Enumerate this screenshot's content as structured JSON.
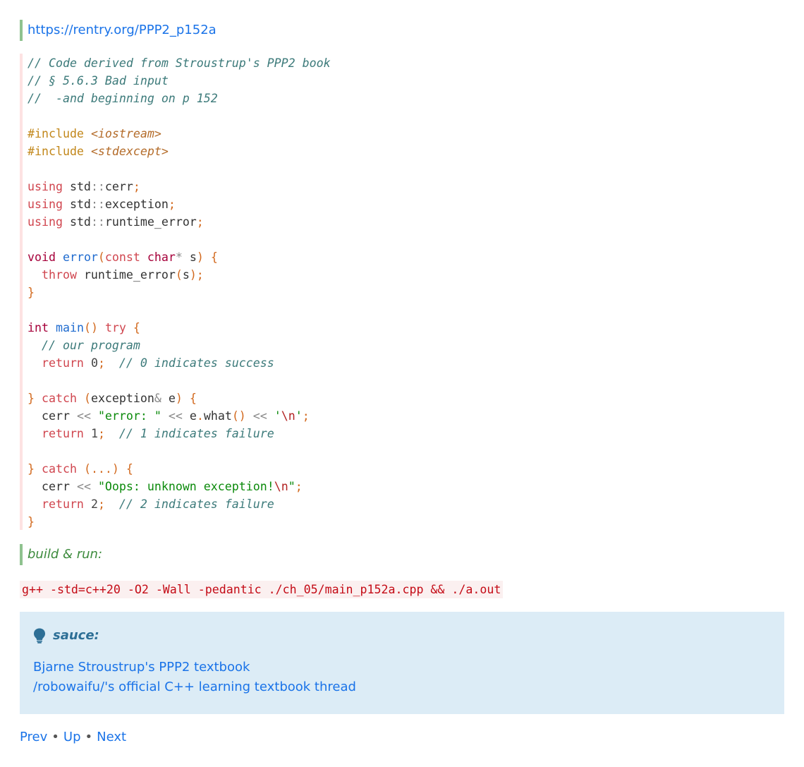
{
  "top_link": {
    "text": "https://rentry.org/PPP2_p152a"
  },
  "code": {
    "c1": "// Code derived from Stroustrup's PPP2 book",
    "c2": "// § 5.6.3 Bad input",
    "c3": "//  -and beginning on p 152",
    "include_kw": "#include",
    "inc1": "<iostream>",
    "inc2": "<stdexcept>",
    "using_kw": "using",
    "std_ns": "std",
    "scope": "::",
    "cerr": "cerr",
    "exception": "exception",
    "runtime_error": "runtime_error",
    "void_kw": "void",
    "error_fn": "error",
    "const_kw": "const",
    "char_kw": "char",
    "star": "*",
    "s": "s",
    "throw_kw": "throw",
    "int_kw": "int",
    "main_fn": "main",
    "try_kw": "try",
    "c_program": "// our program",
    "return_kw": "return",
    "n0": "0",
    "n1": "1",
    "n2": "2",
    "c_success": "// 0 indicates success",
    "catch_kw": "catch",
    "amp": "&",
    "e": "e",
    "shl": "<<",
    "str_error": "\"error: \"",
    "dot": ".",
    "what": "what",
    "newline_char_open": "'",
    "esc_n": "\\n",
    "c_fail1": "// 1 indicates failure",
    "ellipsis": "(...)",
    "str_oops_open": "\"Oops: unknown exception!",
    "str_close": "\"",
    "c_fail2": "// 2 indicates failure"
  },
  "build": {
    "label": "build & run:"
  },
  "command": "g++ -std=c++20 -O2 -Wall -pedantic ./ch_05/main_p152a.cpp && ./a.out",
  "tip": {
    "title": "sauce:",
    "icon": "lightbulb-icon",
    "links": [
      "Bjarne Stroustrup's PPP2 textbook",
      "/robowaifu/'s official C++ learning textbook thread"
    ]
  },
  "nav": {
    "prev": "Prev",
    "up": "Up",
    "next": "Next",
    "sep": "•"
  }
}
